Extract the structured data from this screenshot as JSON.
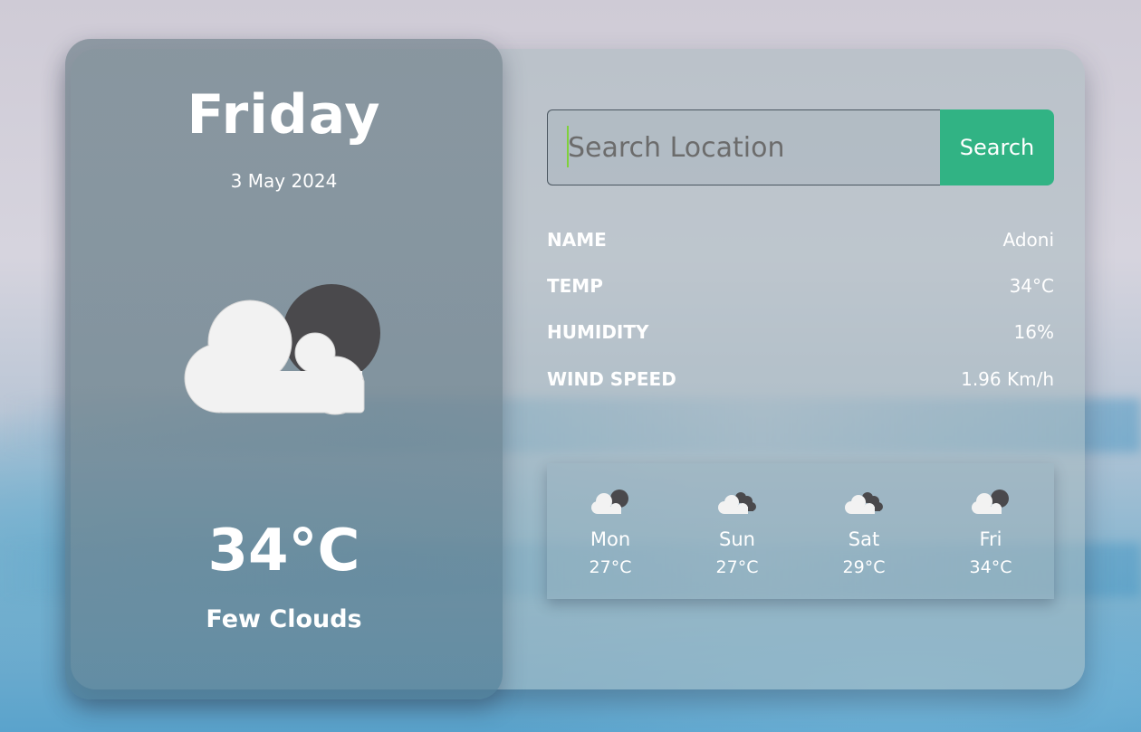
{
  "today": {
    "day": "Friday",
    "date": "3 May 2024",
    "temp": "34°C",
    "description": "Few Clouds",
    "icon": "few-clouds-night-icon"
  },
  "search": {
    "placeholder": "Search Location",
    "value": "",
    "button_label": "Search"
  },
  "details": [
    {
      "label": "NAME",
      "value": "Adoni"
    },
    {
      "label": "TEMP",
      "value": "34°C"
    },
    {
      "label": "HUMIDITY",
      "value": "16%"
    },
    {
      "label": "WIND SPEED",
      "value": "1.96 Km/h"
    }
  ],
  "forecast": [
    {
      "day": "Mon",
      "temp": "27°C",
      "icon": "few-clouds-night-icon"
    },
    {
      "day": "Sun",
      "temp": "27°C",
      "icon": "scattered-clouds-icon"
    },
    {
      "day": "Sat",
      "temp": "29°C",
      "icon": "scattered-clouds-icon"
    },
    {
      "day": "Fri",
      "temp": "34°C",
      "icon": "few-clouds-night-icon"
    }
  ],
  "colors": {
    "accent": "#31b384",
    "text": "#ffffff",
    "moon": "#4a494c",
    "cloud": "#f2f2f2"
  }
}
